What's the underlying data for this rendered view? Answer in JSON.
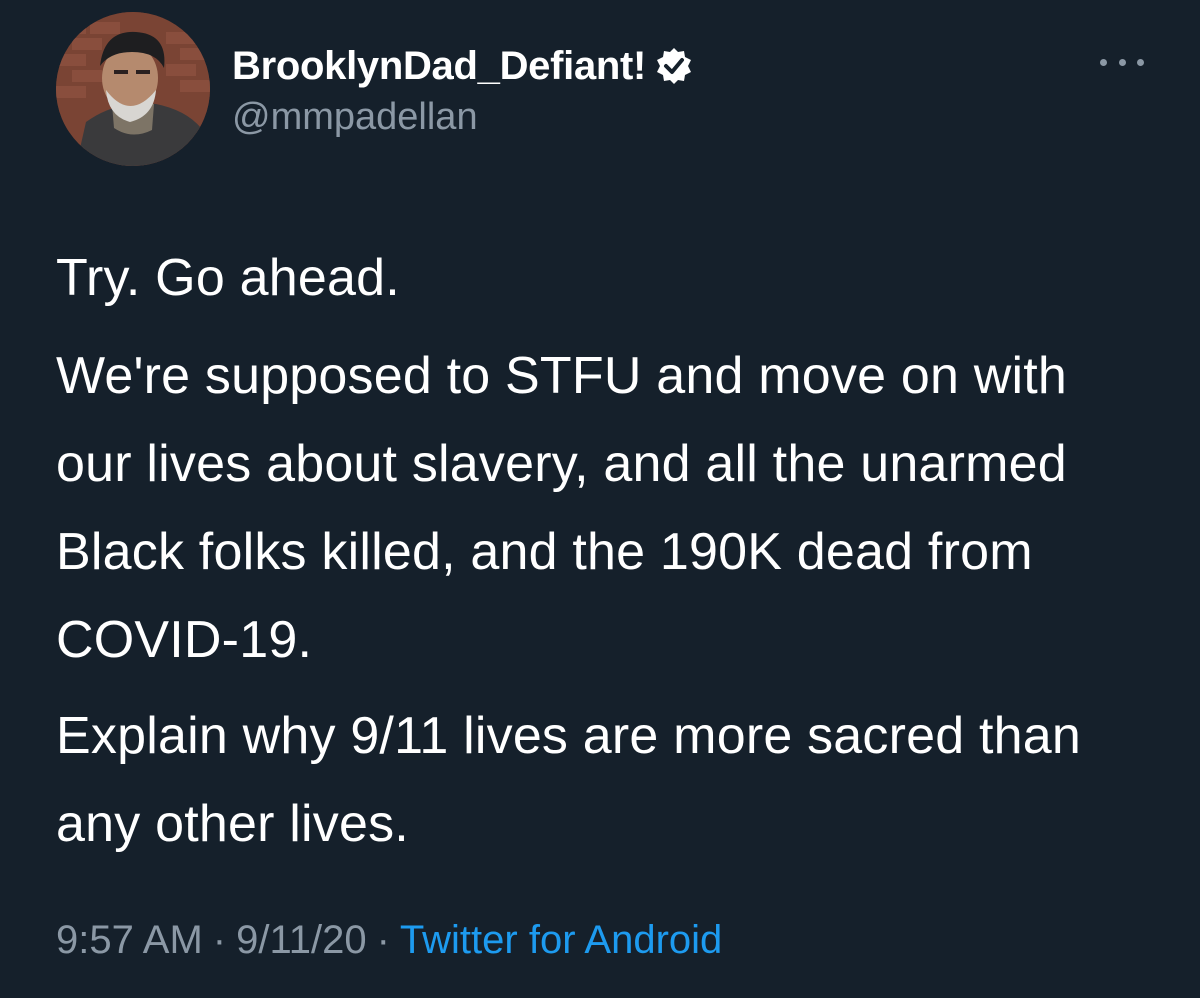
{
  "tweet": {
    "author": {
      "display_name": "BrooklynDad_Defiant!",
      "handle": "@mmpadellan",
      "verified": true,
      "avatar_icon": "profile-photo"
    },
    "more_icon": "ellipsis-icon",
    "paragraphs": [
      "Try. Go ahead.",
      "We're supposed to STFU and move on with our lives about slavery, and all the unarmed Black folks killed, and the 190K dead from COVID-19.",
      "Explain why 9/11 lives are more sacred than any other lives."
    ],
    "time": "9:57 AM",
    "date": "9/11/20",
    "separator": "·",
    "source": "Twitter for Android"
  },
  "colors": {
    "background": "#15202b",
    "text": "#ffffff",
    "secondary": "#8b98a5",
    "link": "#1d9bf0",
    "verified_badge": "#ffffff"
  }
}
